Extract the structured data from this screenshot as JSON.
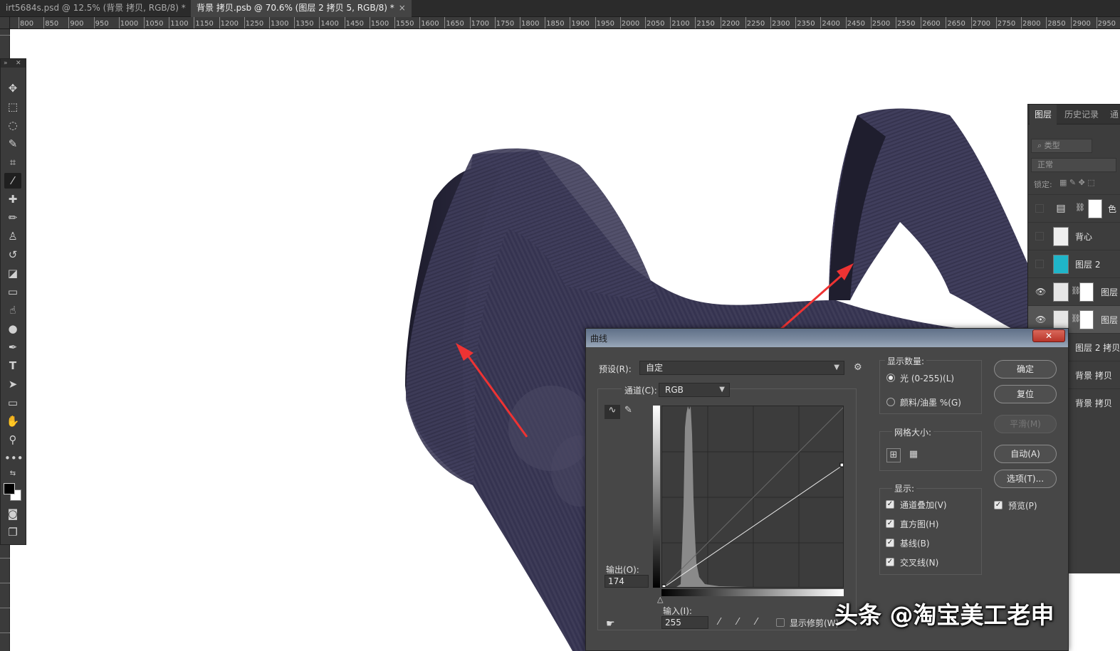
{
  "tabs": [
    {
      "label": "irt5684s.psd @ 12.5% (背景 拷贝, RGB/8) *",
      "close": "×"
    },
    {
      "label": "背景 拷贝.psb @ 70.6% (图层 2 拷贝 5, RGB/8) *",
      "close": "×"
    }
  ],
  "ruler_labels": [
    "800",
    "850",
    "900",
    "950",
    "1000",
    "1050",
    "1100",
    "1150",
    "1200",
    "1250",
    "1300",
    "1350",
    "1400",
    "1450",
    "1500",
    "1550",
    "1600",
    "1650",
    "1700",
    "1750",
    "1800",
    "1850",
    "1900",
    "1950",
    "2000",
    "2050",
    "2100",
    "2150",
    "2200",
    "2250",
    "2300",
    "2350",
    "2400",
    "2450",
    "2500",
    "2550",
    "2600",
    "2650",
    "2700",
    "2750",
    "2800",
    "2850",
    "2900",
    "2950"
  ],
  "tools": [
    "move-icon",
    "marquee-icon",
    "lasso-icon",
    "quick-select-icon",
    "crop-icon",
    "eyedropper-icon",
    "healing-icon",
    "brush-icon",
    "stamp-icon",
    "history-brush-icon",
    "eraser-icon",
    "gradient-icon",
    "smudge-icon",
    "dodge-icon",
    "pen-icon",
    "type-icon",
    "path-select-icon",
    "rectangle-icon",
    "hand-icon",
    "zoom-icon",
    "more-icon"
  ],
  "type_tool_glyph": "T",
  "layers_panel": {
    "tabs": [
      "图层",
      "历史记录",
      "通"
    ],
    "filter_placeholder": "类型",
    "blend_mode": "正常",
    "lock_label": "锁定:",
    "layers": [
      {
        "name": "色",
        "visible": false
      },
      {
        "name": "背心",
        "visible": false
      },
      {
        "name": "图层 2",
        "visible": false
      },
      {
        "name": "图层",
        "visible": true
      },
      {
        "name": "图层",
        "visible": true
      },
      {
        "name": "图层 2 拷贝",
        "visible": false
      },
      {
        "name": "背景 拷贝",
        "visible": false
      },
      {
        "name": "背景 拷贝",
        "visible": false
      }
    ]
  },
  "curves": {
    "title": "曲线",
    "close": "✕",
    "preset_label": "预设(R):",
    "preset_value": "自定",
    "channel_label": "通道(C):",
    "channel_value": "RGB",
    "output_label": "输出(O):",
    "output_value": "174",
    "input_label": "输入(I):",
    "input_value": "255",
    "show_clipping_label": "显示修剪(W)",
    "show_amount": {
      "title": "显示数量:",
      "options": [
        {
          "label": "光 (0-255)(L)",
          "selected": true
        },
        {
          "label": "颜料/油墨 %(G)",
          "selected": false
        }
      ]
    },
    "grid_size_title": "网格大小:",
    "display": {
      "title": "显示:",
      "options": [
        {
          "label": "通道叠加(V)",
          "checked": true
        },
        {
          "label": "直方图(H)",
          "checked": true
        },
        {
          "label": "基线(B)",
          "checked": true
        },
        {
          "label": "交叉线(N)",
          "checked": true
        }
      ]
    },
    "buttons": {
      "ok": "确定",
      "reset": "复位",
      "smooth": "平滑(M)",
      "auto": "自动(A)",
      "options": "选项(T)..."
    },
    "preview": {
      "label": "预览(P)",
      "checked": true
    },
    "curve_points": [
      [
        0,
        0
      ],
      [
        255,
        174
      ]
    ]
  },
  "watermark": "头条 @淘宝美工老申",
  "colors": {
    "accent_red": "#ee3333",
    "garment": "#3f3d5a",
    "layer_cyan": "#1fb5c9"
  }
}
